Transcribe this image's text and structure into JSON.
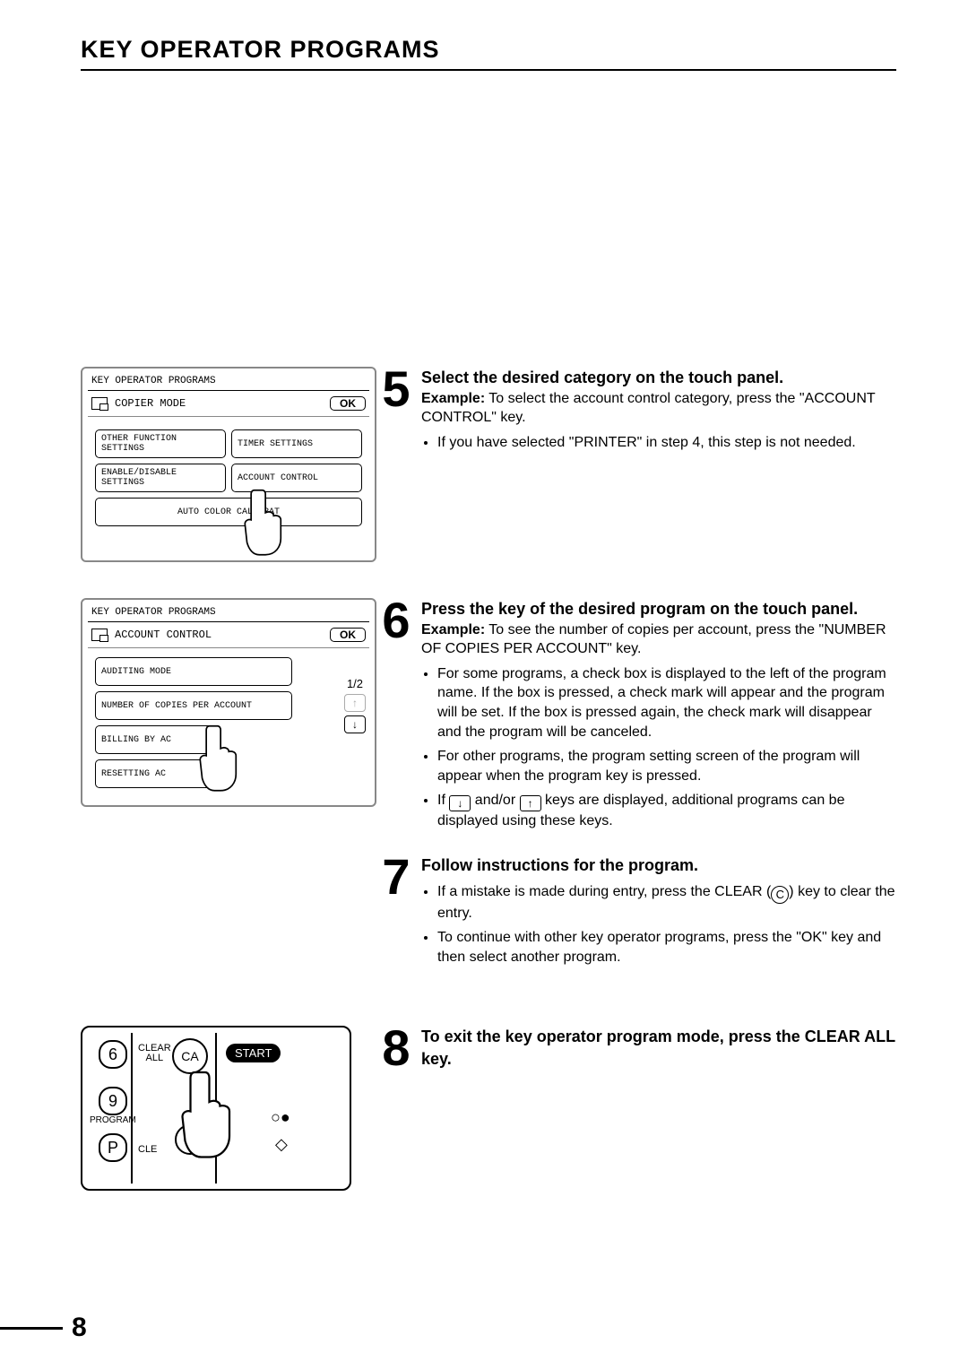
{
  "header": {
    "title": "KEY OPERATOR PROGRAMS"
  },
  "panel5": {
    "title": "KEY OPERATOR PROGRAMS",
    "mode": "COPIER MODE",
    "ok": "OK",
    "buttons": {
      "other_function": "OTHER FUNCTION SETTINGS",
      "timer": "TIMER SETTINGS",
      "enable_disable": "ENABLE/DISABLE SETTINGS",
      "account": "ACCOUNT CONTROL",
      "auto_color": "AUTO COLOR CALIBRAT"
    }
  },
  "panel6": {
    "title": "KEY OPERATOR PROGRAMS",
    "mode": "ACCOUNT CONTROL",
    "ok": "OK",
    "page": "1/2",
    "items": {
      "a": "AUDITING MODE",
      "b": "NUMBER OF COPIES PER ACCOUNT",
      "c": "BILLING BY AC",
      "d": "RESETTING AC"
    }
  },
  "step5": {
    "head": "Select the desired category on the touch panel.",
    "example_label": "Example:",
    "example_text": "To select the account control category, press the \"ACCOUNT CONTROL\" key.",
    "bullet1": "If you have selected \"PRINTER\" in step 4, this step is not needed."
  },
  "step6": {
    "head": "Press the key of the desired program on the touch panel.",
    "example_label": "Example:",
    "example_text": "To see the number of copies per account, press the \"NUMBER OF COPIES PER ACCOUNT\" key.",
    "bullet1": "For some programs, a check box is displayed to the left of the program name. If the box is pressed, a check mark will appear and the program will be set. If the box is pressed again, the check mark will disappear and the program will be canceled.",
    "bullet2": "For other programs, the program setting screen of the program will appear when the program key is pressed.",
    "bullet3a": "If ",
    "bullet3b": " and/or ",
    "bullet3c": " keys are displayed, additional programs can be displayed using these keys."
  },
  "step7": {
    "head": "Follow instructions for the program.",
    "bullet1a": "If a mistake is made during entry, press the CLEAR (",
    "bullet1b": ") key to clear the entry.",
    "bullet2": "To continue with other key operator programs, press the \"OK\" key and then select another program."
  },
  "step8": {
    "head": "To exit the key operator program mode, press the CLEAR ALL key."
  },
  "keypad": {
    "k6": "6",
    "k9": "9",
    "kp": "P",
    "program": "PROGRAM",
    "clear_all": "CLEAR\nALL",
    "clear": "CLE",
    "ca": "CA",
    "c": "C",
    "start": "START"
  },
  "icons": {
    "down": "↓",
    "up": "↑",
    "c": "C"
  },
  "page_number": "8"
}
